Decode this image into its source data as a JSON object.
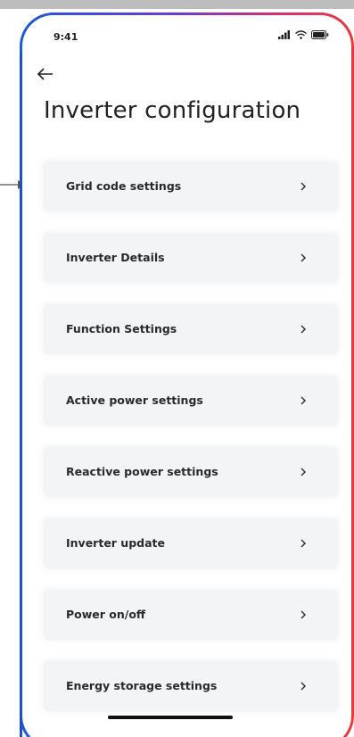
{
  "status_bar": {
    "time": "9:41"
  },
  "header": {
    "title": "Inverter configuration"
  },
  "settings": {
    "items": [
      {
        "label": "Grid code settings"
      },
      {
        "label": "Inverter Details"
      },
      {
        "label": "Function Settings"
      },
      {
        "label": "Active power settings"
      },
      {
        "label": "Reactive power settings"
      },
      {
        "label": "Inverter update"
      },
      {
        "label": "Power on/off"
      },
      {
        "label": "Energy storage settings"
      }
    ]
  },
  "icons": {
    "back": "back-arrow-icon",
    "chevron": "chevron-right-icon",
    "signal": "signal-icon",
    "wifi": "wifi-icon",
    "battery": "battery-icon",
    "pointer": "pointer-arrow-icon"
  },
  "colors": {
    "item_background": "#f3f4f5",
    "frame_gradient_start": "#1d5ad9",
    "frame_gradient_end": "#e83a3a",
    "text": "#2a2a2a"
  }
}
